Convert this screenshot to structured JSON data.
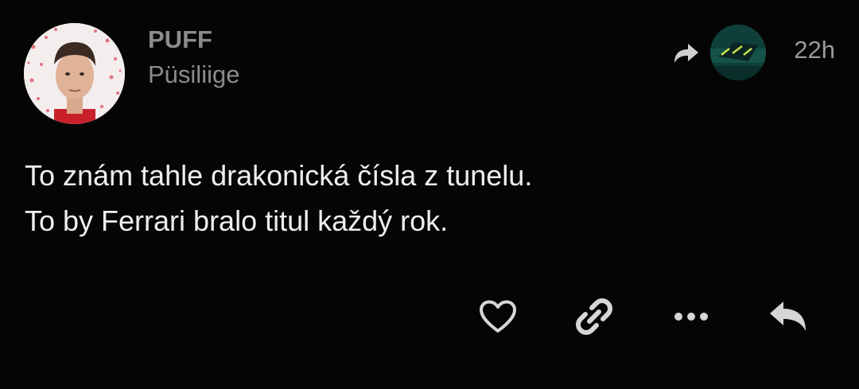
{
  "post": {
    "author": {
      "name": "PUFF",
      "role": "Püsiliige",
      "avatar_icon": "person-avatar"
    },
    "boosted_by_icon": "boosted-avatar",
    "timestamp": "22h",
    "content": {
      "lines": [
        "To znám tahle drakonická čísla z tunelu.",
        "To by Ferrari bralo titul každý rok."
      ]
    },
    "actions": [
      {
        "name": "favourite",
        "icon": "heart-icon"
      },
      {
        "name": "copy-link",
        "icon": "link-icon"
      },
      {
        "name": "more",
        "icon": "more-icon"
      },
      {
        "name": "reply",
        "icon": "reply-icon"
      }
    ]
  },
  "colors": {
    "background": "#050506",
    "text": "#efefef",
    "muted": "#8c8c8c",
    "icon": "#d6d6d6"
  }
}
